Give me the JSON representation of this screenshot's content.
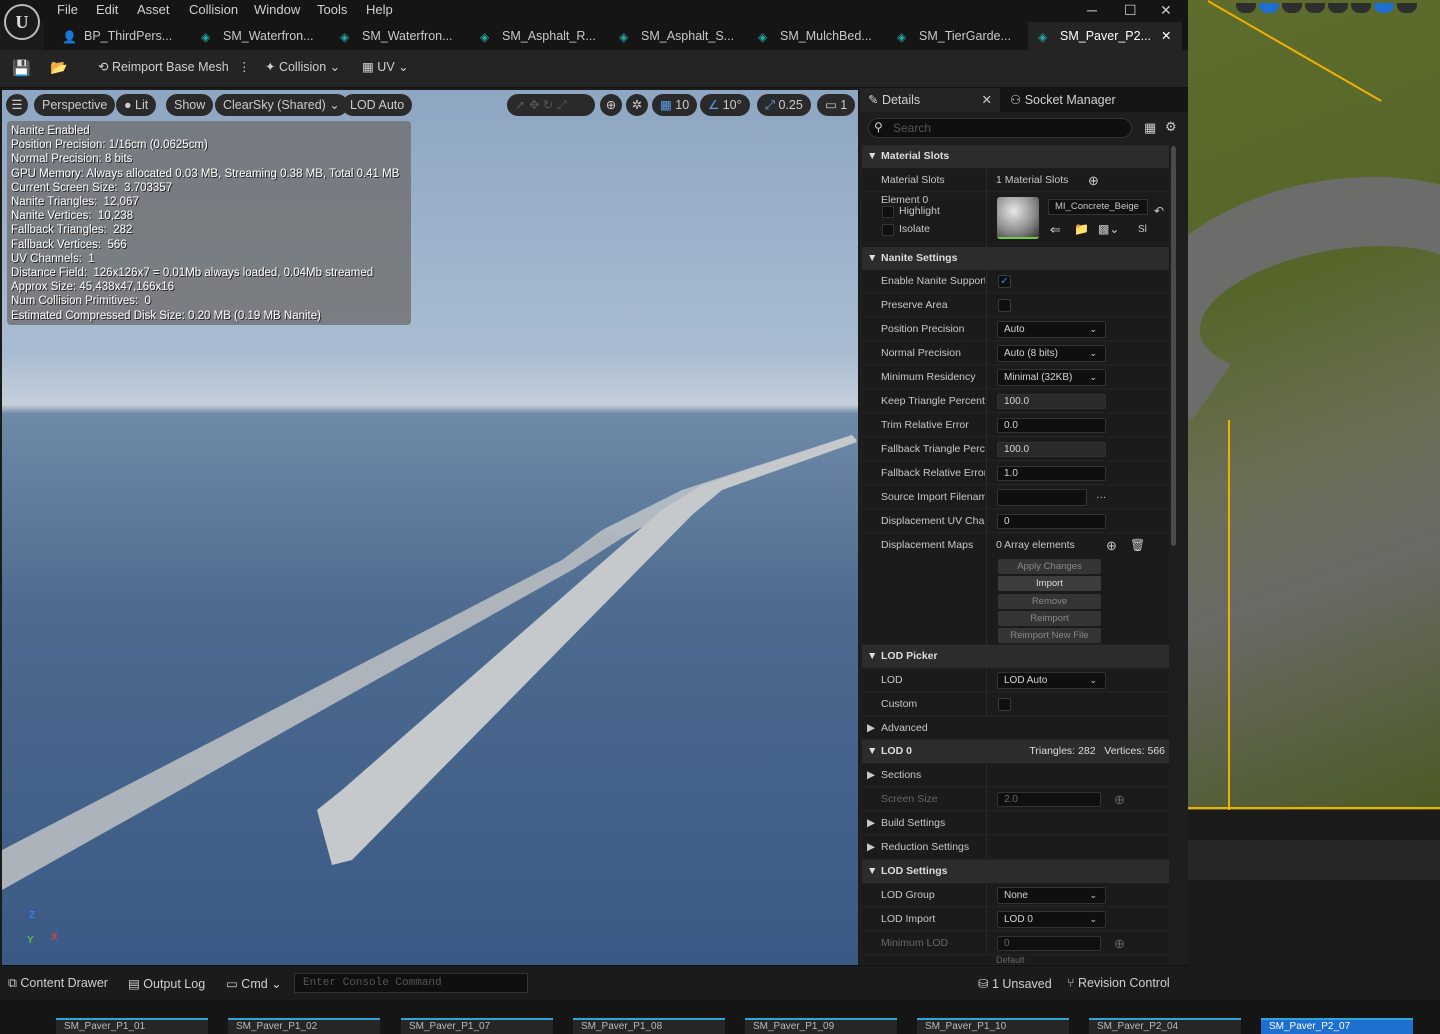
{
  "menu": [
    "File",
    "Edit",
    "Asset",
    "Collision",
    "Window",
    "Tools",
    "Help"
  ],
  "tabs": [
    "BP_ThirdPers...",
    "SM_Waterfron...",
    "SM_Waterfron...",
    "SM_Asphalt_R...",
    "SM_Asphalt_S...",
    "SM_MulchBed...",
    "SM_TierGarde...",
    "SM_Paver_P2..."
  ],
  "toolbar": {
    "reimport": "Reimport Base Mesh",
    "collision": "Collision",
    "uv": "UV"
  },
  "viewport": {
    "perspective": "Perspective",
    "lit": "Lit",
    "show": "Show",
    "sky": "ClearSky (Shared)",
    "lod": "LOD Auto",
    "grid": "10",
    "angle": "10°",
    "scale": "0.25",
    "cam": "1",
    "stats": [
      "Nanite Enabled",
      "Position Precision: 1/16cm (0.0625cm)",
      "Normal Precision: 8 bits",
      "GPU Memory: Always allocated 0.03 MB, Streaming 0.38 MB, Total 0.41 MB",
      "Current Screen Size:  3.703357",
      "Nanite Triangles:  12,067",
      "Nanite Vertices:  10,238",
      "Fallback Triangles:  282",
      "Fallback Vertices:  566",
      "UV Channels:  1",
      "Distance Field:  126x126x7 = 0.01Mb always loaded, 0.04Mb streamed",
      "Approx Size: 45,438x47,166x16",
      "Num Collision Primitives:  0",
      "Estimated Compressed Disk Size: 0.20 MB (0.19 MB Nanite)"
    ]
  },
  "details": {
    "tab_details": "Details",
    "tab_socket": "Socket Manager",
    "search_placeholder": "Search",
    "material_slots_cat": "Material Slots",
    "material_slots_label": "Material Slots",
    "material_slots_value": "1 Material Slots",
    "element0": "Element 0",
    "highlight": "Highlight",
    "isolate": "Isolate",
    "material_name": "MI_Concrete_Beige",
    "sl": "Sl",
    "nanite_cat": "Nanite Settings",
    "enable_nanite": "Enable Nanite Support",
    "preserve_area": "Preserve Area",
    "position_precision": "Position Precision",
    "position_precision_val": "Auto",
    "normal_precision": "Normal Precision",
    "normal_precision_val": "Auto (8 bits)",
    "min_residency": "Minimum Residency",
    "min_residency_val": "Minimal (32KB)",
    "keep_tri": "Keep Triangle Percent",
    "keep_tri_val": "100.0",
    "trim_err": "Trim Relative Error",
    "trim_err_val": "0.0",
    "fallback_tri": "Fallback Triangle Percen",
    "fallback_tri_val": "100.0",
    "fallback_err": "Fallback Relative Error",
    "fallback_err_val": "1.0",
    "source_import": "Source Import Filename",
    "disp_uv": "Displacement UV Channe",
    "disp_uv_val": "0",
    "disp_maps": "Displacement Maps",
    "disp_maps_val": "0 Array elements",
    "apply": "Apply Changes",
    "import": "Import",
    "remove": "Remove",
    "reimport": "Reimport",
    "reimport_new": "Reimport New File",
    "lodpicker_cat": "LOD Picker",
    "lod": "LOD",
    "lod_val": "LOD Auto",
    "custom": "Custom",
    "advanced": "Advanced",
    "lod0_cat": "LOD 0",
    "lod0_stats": "Triangles: 282   Vertices: 566",
    "sections": "Sections",
    "screen_size": "Screen Size",
    "screen_size_val": "2.0",
    "build": "Build Settings",
    "reduction": "Reduction Settings",
    "lodsettings_cat": "LOD Settings",
    "lod_group": "LOD Group",
    "lod_group_val": "None",
    "lod_import": "LOD Import",
    "lod_import_val": "LOD 0",
    "min_lod": "Minimum LOD",
    "min_lod_val": "0",
    "default": "Default"
  },
  "status": {
    "content": "Content Drawer",
    "output": "Output Log",
    "cmd": "Cmd",
    "console_placeholder": "Enter Console Command",
    "unsaved": "1 Unsaved",
    "revision": "Revision Control"
  },
  "thumbs": [
    "SM_Paver_P1_01",
    "SM_Paver_P1_02",
    "SM_Paver_P1_07",
    "SM_Paver_P1_08",
    "SM_Paver_P1_09",
    "SM_Paver_P1_10",
    "SM_Paver_P2_04",
    "SM_Paver_P2_07"
  ],
  "colors": {
    "accent": "#1f6fd0",
    "highlight": "#f0b000",
    "teal": "#23a9a6"
  }
}
